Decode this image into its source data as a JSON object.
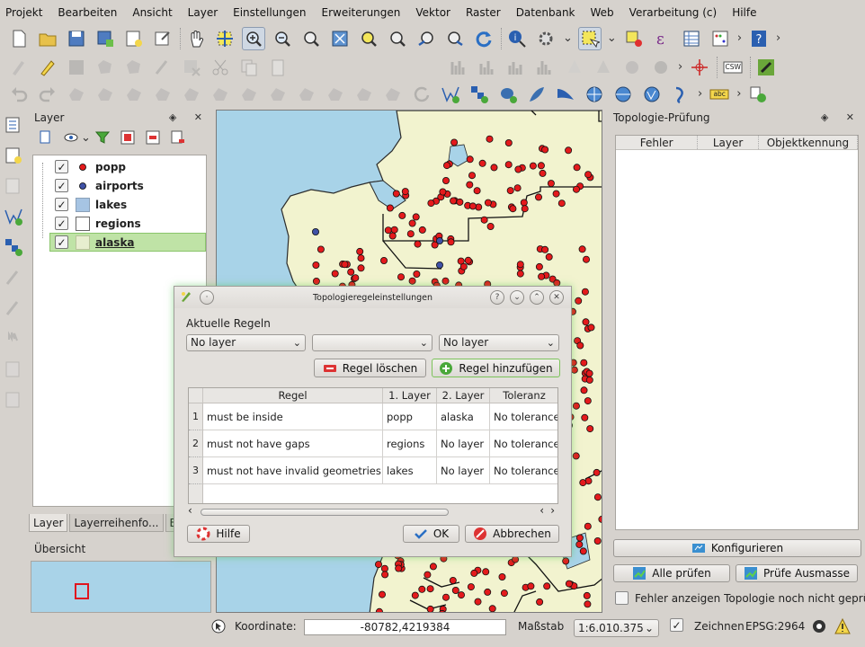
{
  "menu": [
    "Projekt",
    "Bearbeiten",
    "Ansicht",
    "Layer",
    "Einstellungen",
    "Erweiterungen",
    "Vektor",
    "Raster",
    "Datenbank",
    "Web",
    "Verarbeitung (c)",
    "Hilfe"
  ],
  "toolbar": {
    "chevron": "›",
    "csw_label": "CSW",
    "abc_label": "abc"
  },
  "layer_panel": {
    "title": "Layer",
    "controls": "◈ ✕",
    "layers": [
      {
        "name": "popp",
        "symbol": "point",
        "color": "#e41a1c",
        "checked": "✓"
      },
      {
        "name": "airports",
        "symbol": "point",
        "color": "#3f51a6",
        "checked": "✓"
      },
      {
        "name": "lakes",
        "symbol": "polygon",
        "color": "#a6c4e3",
        "checked": "✓"
      },
      {
        "name": "regions",
        "symbol": "polygon",
        "color": "#ffffff",
        "checked": "✓"
      },
      {
        "name": "alaska",
        "symbol": "polygon",
        "color": "#e7eecf",
        "checked": "✓"
      }
    ],
    "tabs": [
      "Layer",
      "Layerreihenfo...",
      "B"
    ]
  },
  "overview": {
    "title": "Übersicht"
  },
  "topology_panel": {
    "title": "Topologie-Prüfung",
    "controls": "◈ ✕",
    "columns": [
      "Fehler",
      "Layer",
      "Objektkennung"
    ],
    "configure_button": "Konfigurieren",
    "check_all_button": "Alle prüfen",
    "check_extent_button": "Prüfe Ausmasse",
    "show_errors_label": "Fehler anzeigen Topologie noch nicht geprüft"
  },
  "dialog": {
    "title": "Topologieregeleinstellungen",
    "title_buttons": [
      "?",
      "⌄",
      "⌃",
      "✕"
    ],
    "current_rules_label": "Aktuelle Regeln",
    "combo1": "No layer",
    "combo2": "",
    "combo3": "No layer",
    "combo_arrow": "⌄",
    "delete_rule_button": "Regel löschen",
    "add_rule_button": "Regel hinzufügen",
    "columns": [
      "Regel",
      "1. Layer",
      "2. Layer",
      "Toleranz"
    ],
    "rules": [
      {
        "num": "1",
        "rule": "must be inside",
        "layer1": "popp",
        "layer2": "alaska",
        "tolerance": "No tolerance"
      },
      {
        "num": "2",
        "rule": "must not have gaps",
        "layer1": "regions",
        "layer2": "No layer",
        "tolerance": "No tolerance"
      },
      {
        "num": "3",
        "rule": "must not have invalid geometries",
        "layer1": "lakes",
        "layer2": "No layer",
        "tolerance": "No tolerance"
      }
    ],
    "scroll_left": "‹",
    "scroll_right": "›",
    "help_button": "Hilfe",
    "ok_button": "OK",
    "cancel_button": "Abbrechen"
  },
  "statusbar": {
    "coordinate_label": "Koordinate:",
    "coordinate_value": "-80782,4219384",
    "scale_label": "Maßstab",
    "scale_value": "1:6.010.375",
    "scale_arrow": "⌄",
    "render_label": "Zeichnen",
    "render_checked": "✓",
    "crs": "EPSG:2964"
  },
  "colors": {
    "land": "#f2f3cf",
    "water": "#a8d3e8",
    "popp_point": "#e41a1c",
    "airport_point": "#3f51a6",
    "selection": "#bfe3a6"
  }
}
